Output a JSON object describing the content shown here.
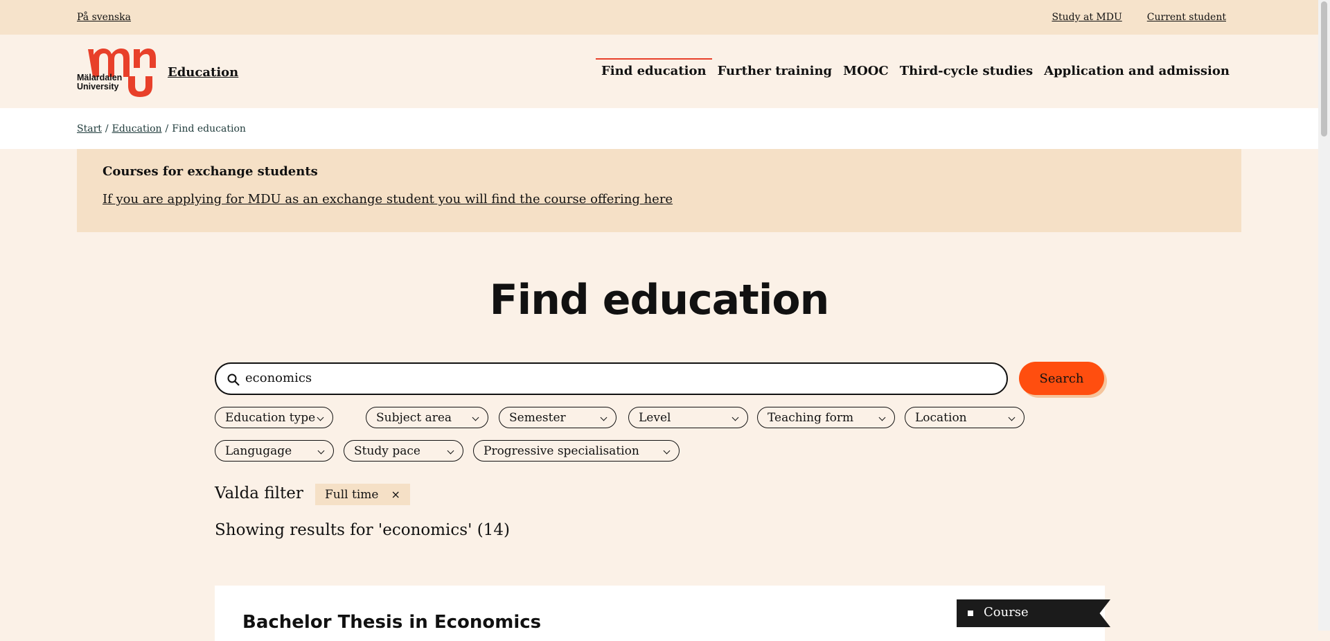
{
  "topbar": {
    "language_link": "På svenska",
    "links": [
      "Study at MDU",
      "Current student"
    ]
  },
  "header": {
    "logo_text": "Mälardalen University",
    "section_link": "Education",
    "nav": [
      "Find education",
      "Further training",
      "MOOC",
      "Third-cycle studies",
      "Application and admission"
    ],
    "active_nav": "Find education"
  },
  "breadcrumb": {
    "items": [
      "Start",
      "Education",
      "Find education"
    ],
    "separator": "/"
  },
  "notice": {
    "title": "Courses for exchange students",
    "link": "If you are applying for MDU as an exchange student you will find the course offering here"
  },
  "main": {
    "title": "Find education",
    "search": {
      "value": "economics",
      "button_label": "Search",
      "icon": "search-icon"
    },
    "filters": [
      "Education type",
      "Subject area",
      "Semester",
      "Level",
      "Teaching form",
      "Location",
      "Langugage",
      "Study pace",
      "Progressive specialisation"
    ],
    "selected_filters_label": "Valda filter",
    "selected_filters": [
      {
        "label": "Full time",
        "remove": "×"
      }
    ],
    "results_summary": "Showing results for 'economics' (14)",
    "results": [
      {
        "title": "Bachelor Thesis in Economics",
        "type": "Course"
      }
    ]
  },
  "colors": {
    "accent": "#ff4e0f",
    "logo": "#e8402a",
    "topbar_bg": "#f6e3cb",
    "page_bg": "#fbf1e7",
    "notice_bg": "#f5e0c6"
  }
}
